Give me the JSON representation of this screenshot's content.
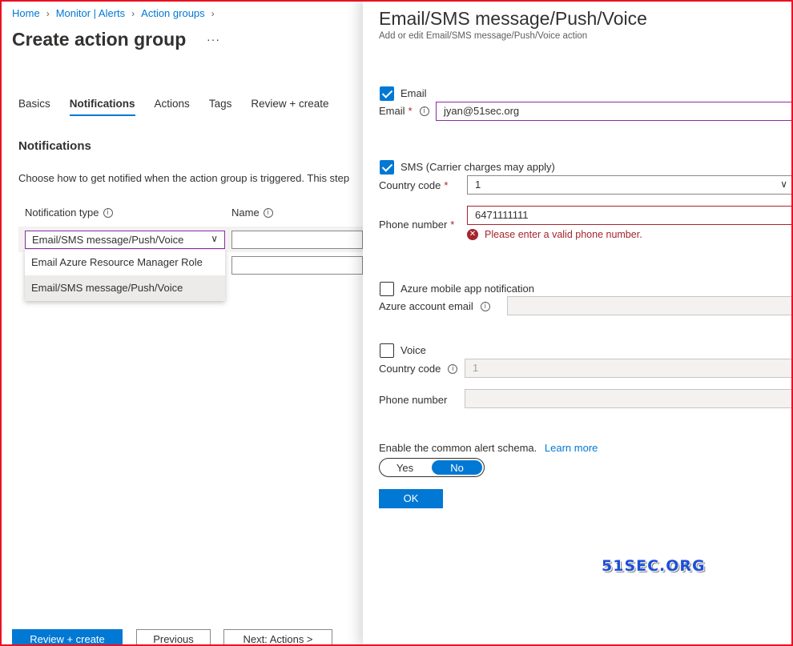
{
  "breadcrumb": [
    "Home",
    "Monitor | Alerts",
    "Action groups"
  ],
  "page": {
    "title": "Create action group",
    "more": "···"
  },
  "tabs": [
    {
      "label": "Basics",
      "active": false
    },
    {
      "label": "Notifications",
      "active": true
    },
    {
      "label": "Actions",
      "active": false
    },
    {
      "label": "Tags",
      "active": false
    },
    {
      "label": "Review + create",
      "active": false
    }
  ],
  "notifications": {
    "title": "Notifications",
    "description": "Choose how to get notified when the action group is triggered. This step",
    "col_type": "Notification type",
    "col_name": "Name",
    "selected_type": "Email/SMS message/Push/Voice",
    "name_value": "",
    "dropdown_options": [
      "Email Azure Resource Manager Role",
      "Email/SMS message/Push/Voice"
    ]
  },
  "footer": {
    "review_create": "Review + create",
    "previous": "Previous",
    "next": "Next: Actions >"
  },
  "panel": {
    "title": "Email/SMS message/Push/Voice",
    "subtitle": "Add or edit Email/SMS message/Push/Voice action",
    "email": {
      "checkbox_label": "Email",
      "checked": true,
      "field_label": "Email",
      "value": "jyan@51sec.org"
    },
    "sms": {
      "checkbox_label": "SMS (Carrier charges may apply)",
      "checked": true,
      "country_label": "Country code",
      "country_value": "1",
      "phone_label": "Phone number",
      "phone_value": "6471111111",
      "error": "Please enter a valid phone number."
    },
    "push": {
      "checkbox_label": "Azure mobile app notification",
      "checked": false,
      "account_label": "Azure account email",
      "account_value": ""
    },
    "voice": {
      "checkbox_label": "Voice",
      "checked": false,
      "country_label": "Country code",
      "country_value": "1",
      "phone_label": "Phone number",
      "phone_value": ""
    },
    "schema": {
      "label": "Enable the common alert schema.",
      "link": "Learn more",
      "yes": "Yes",
      "no": "No",
      "selected": "No"
    },
    "ok": "OK"
  },
  "watermark": "51SEC.ORG",
  "colors": {
    "accent": "#0078d4",
    "error": "#a4262c",
    "focus": "#8a2da5",
    "frame": "#e81123"
  },
  "icons": {
    "info": "info-icon",
    "chevron": "chevron-down-icon",
    "error": "error-circle-icon",
    "check": "checkmark-icon"
  }
}
